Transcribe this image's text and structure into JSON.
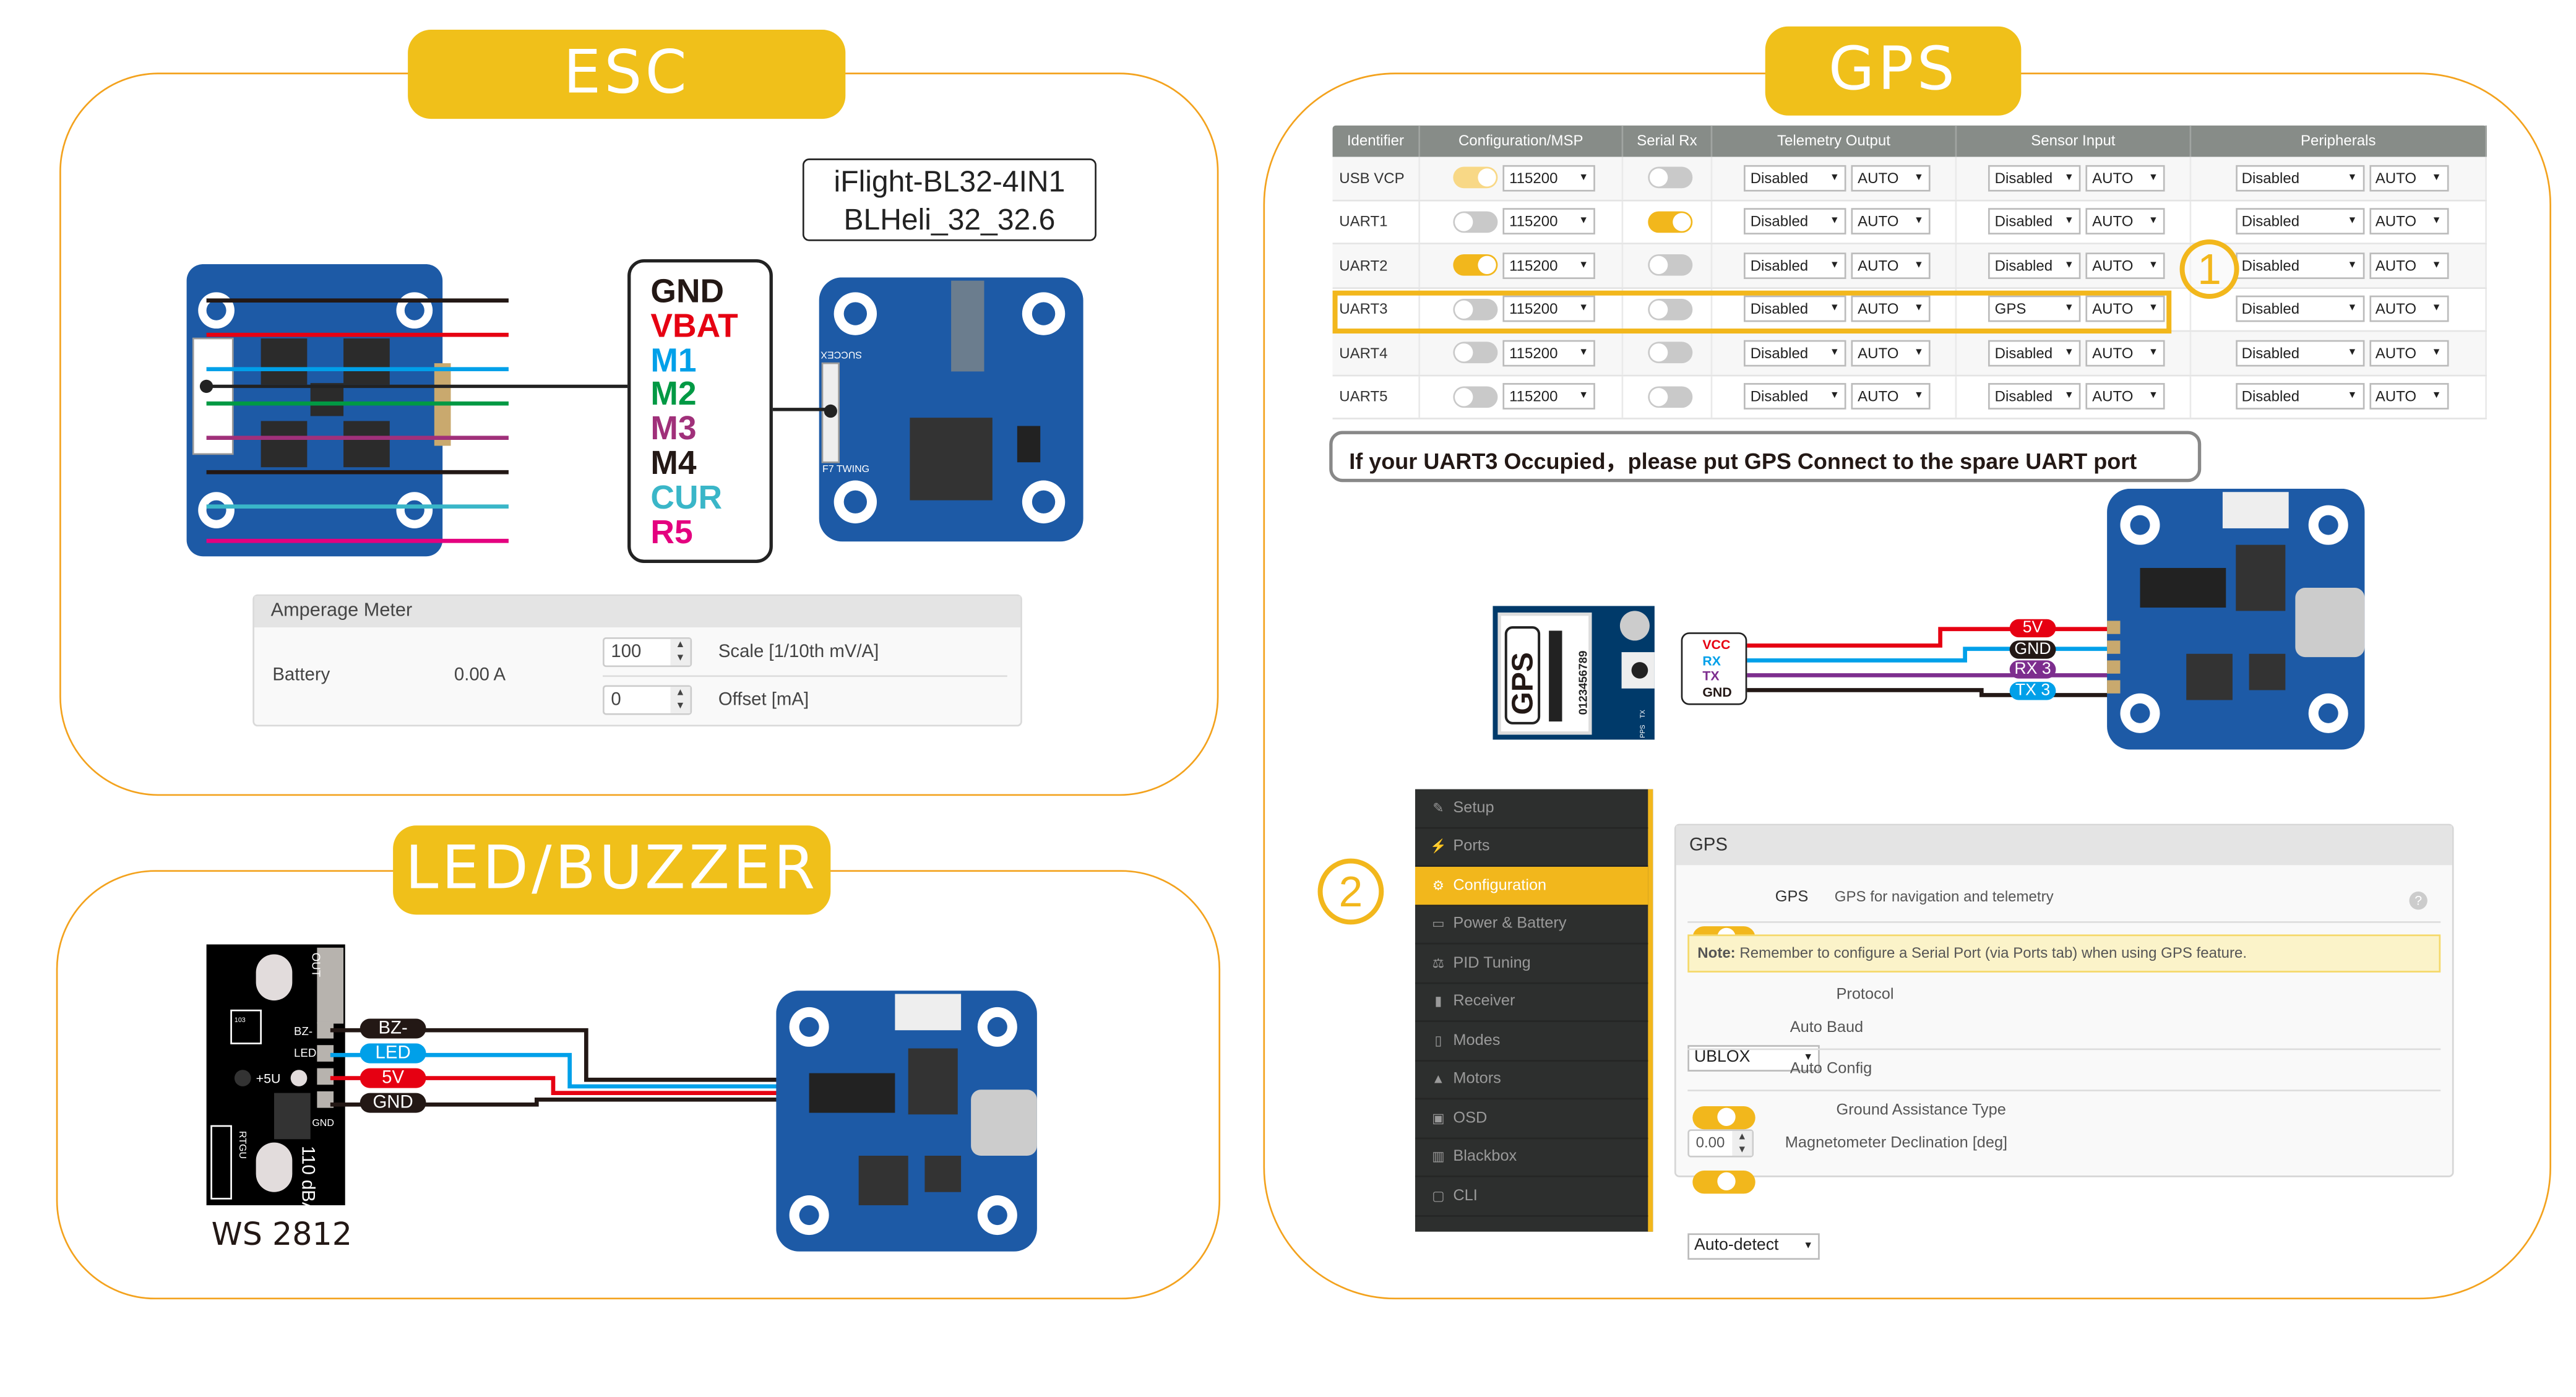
{
  "colors": {
    "accent": "#f2b71c",
    "panel_border": "#f3a21d",
    "board_blue": "#1d5aa6",
    "wire_red": "#e60012",
    "wire_blue": "#00a0e9",
    "wire_purple": "#7d2e8e",
    "wire_black": "#231815"
  },
  "esc": {
    "title": "ESC",
    "esc_name": "iFlight-BL32-4IN1",
    "firmware": "BLHeli_32_32.6",
    "pins": [
      {
        "label": "GND",
        "color": "#231815"
      },
      {
        "label": "VBAT",
        "color": "#e60012"
      },
      {
        "label": "M1",
        "color": "#00a0e9"
      },
      {
        "label": "M2",
        "color": "#009944"
      },
      {
        "label": "M3",
        "color": "#a0307a"
      },
      {
        "label": "M4",
        "color": "#231815"
      },
      {
        "label": "CUR",
        "color": "#3ab6c8"
      },
      {
        "label": "R5",
        "color": "#e4007f"
      }
    ],
    "fc_silk": [
      "SUCCEX",
      "F7 TWING"
    ],
    "amperage": {
      "title": "Amperage Meter",
      "source": "Battery",
      "reading": "0.00 A",
      "scale_value": "100",
      "scale_label": "Scale [1/10th mV/A]",
      "offset_value": "0",
      "offset_label": "Offset [mA]"
    }
  },
  "led": {
    "title": "LED/BUZZER",
    "module_name": "WS 2812",
    "silk": {
      "out": "OUT",
      "bz": "BZ-",
      "led": "LED",
      "v5": "+5U",
      "gnd": "GND",
      "rtgu": "RTGU",
      "dba": "110 dBA",
      "res": "103",
      "r101": "101"
    },
    "wires": [
      {
        "label": "BZ-",
        "color": "#231815"
      },
      {
        "label": "LED",
        "color": "#00a0e9"
      },
      {
        "label": "5V",
        "color": "#e60012"
      },
      {
        "label": "GND",
        "color": "#231815"
      }
    ]
  },
  "gps": {
    "title": "GPS",
    "ports_table": {
      "headers": [
        "Identifier",
        "Configuration/MSP",
        "Serial Rx",
        "Telemetry Output",
        "Sensor Input",
        "Peripherals"
      ],
      "rows": [
        {
          "id": "USB VCP",
          "msp": "pale",
          "baud": "115200",
          "rx": false,
          "tele": "Disabled",
          "tele_baud": "AUTO",
          "sensor": "Disabled",
          "sensor_baud": "AUTO",
          "periph": "Disabled",
          "periph_baud": "AUTO"
        },
        {
          "id": "UART1",
          "msp": "off",
          "baud": "115200",
          "rx": true,
          "tele": "Disabled",
          "tele_baud": "AUTO",
          "sensor": "Disabled",
          "sensor_baud": "AUTO",
          "periph": "Disabled",
          "periph_baud": "AUTO"
        },
        {
          "id": "UART2",
          "msp": "on",
          "baud": "115200",
          "rx": false,
          "tele": "Disabled",
          "tele_baud": "AUTO",
          "sensor": "Disabled",
          "sensor_baud": "AUTO",
          "periph": "Disabled",
          "periph_baud": "AUTO"
        },
        {
          "id": "UART3",
          "msp": "off",
          "baud": "115200",
          "rx": false,
          "tele": "Disabled",
          "tele_baud": "AUTO",
          "sensor": "GPS",
          "sensor_baud": "AUTO",
          "periph": "Disabled",
          "periph_baud": "AUTO"
        },
        {
          "id": "UART4",
          "msp": "off",
          "baud": "115200",
          "rx": false,
          "tele": "Disabled",
          "tele_baud": "AUTO",
          "sensor": "Disabled",
          "sensor_baud": "AUTO",
          "periph": "Disabled",
          "periph_baud": "AUTO"
        },
        {
          "id": "UART5",
          "msp": "off",
          "baud": "115200",
          "rx": false,
          "tele": "Disabled",
          "tele_baud": "AUTO",
          "sensor": "Disabled",
          "sensor_baud": "AUTO",
          "periph": "Disabled",
          "periph_baud": "AUTO"
        }
      ]
    },
    "step1": "1",
    "step2": "2",
    "note": "If your UART3 Occupied，please put GPS Connect to the spare UART port",
    "module": {
      "label": "GPS",
      "serial": "0123456789",
      "tx": "TX",
      "pps": "PPS"
    },
    "module_pins": [
      {
        "label": "VCC",
        "color": "#e60012"
      },
      {
        "label": "RX",
        "color": "#00a0e9"
      },
      {
        "label": "TX",
        "color": "#7d2e8e"
      },
      {
        "label": "GND",
        "color": "#231815"
      }
    ],
    "fc_pins": [
      {
        "label": "5V",
        "color": "#e60012"
      },
      {
        "label": "GND",
        "color": "#231815"
      },
      {
        "label": "RX 3",
        "color": "#7d2e8e"
      },
      {
        "label": "TX 3",
        "color": "#00a0e9"
      }
    ],
    "sidebar": {
      "items": [
        {
          "label": "Setup",
          "icon": "wrench-icon",
          "glyph": "✎"
        },
        {
          "label": "Ports",
          "icon": "plug-icon",
          "glyph": "⚡"
        },
        {
          "label": "Configuration",
          "icon": "gear-icon",
          "glyph": "⚙",
          "active": true
        },
        {
          "label": "Power & Battery",
          "icon": "battery-icon",
          "glyph": "▭"
        },
        {
          "label": "PID Tuning",
          "icon": "sliders-icon",
          "glyph": "⚖"
        },
        {
          "label": "Receiver",
          "icon": "remote-icon",
          "glyph": "▮"
        },
        {
          "label": "Modes",
          "icon": "switch-icon",
          "glyph": "▯"
        },
        {
          "label": "Motors",
          "icon": "motor-icon",
          "glyph": "▲"
        },
        {
          "label": "OSD",
          "icon": "osd-icon",
          "glyph": "▣"
        },
        {
          "label": "Blackbox",
          "icon": "blackbox-icon",
          "glyph": "▥"
        },
        {
          "label": "CLI",
          "icon": "terminal-icon",
          "glyph": "▢"
        }
      ]
    },
    "config": {
      "title": "GPS",
      "gps_toggle": true,
      "gps_label": "GPS",
      "gps_desc": "GPS for navigation and telemetry",
      "help": "?",
      "note_bold": "Note:",
      "note_text": " Remember to configure a Serial Port (via Ports tab) when using GPS feature.",
      "protocol_value": "UBLOX",
      "protocol_label": "Protocol",
      "auto_baud": true,
      "auto_baud_label": "Auto Baud",
      "auto_config": true,
      "auto_config_label": "Auto Config",
      "ground_value": "Auto-detect",
      "ground_label": "Ground Assistance Type",
      "mag_value": "0.00",
      "mag_label": "Magnetometer Declination [deg]"
    }
  }
}
